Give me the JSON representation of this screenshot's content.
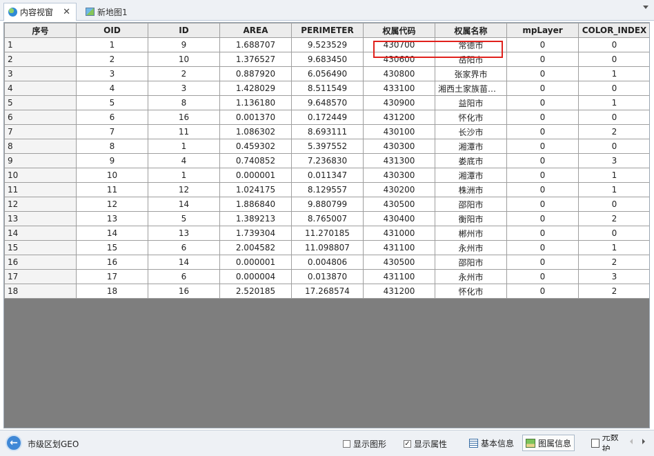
{
  "tabs": [
    {
      "label": "内容视窗",
      "active": true
    },
    {
      "label": "新地图1",
      "active": false
    }
  ],
  "table": {
    "columns": [
      "序号",
      "OID",
      "ID",
      "AREA",
      "PERIMETER",
      "权属代码",
      "权属名称",
      "mpLayer",
      "COLOR_INDEX"
    ],
    "rows": [
      [
        "1",
        "1",
        "9",
        "1.688707",
        "9.523529",
        "430700",
        "常德市",
        "0",
        "0"
      ],
      [
        "2",
        "2",
        "10",
        "1.376527",
        "9.683450",
        "430600",
        "岳阳市",
        "0",
        "0"
      ],
      [
        "3",
        "3",
        "2",
        "0.887920",
        "6.056490",
        "430800",
        "张家界市",
        "0",
        "1"
      ],
      [
        "4",
        "4",
        "3",
        "1.428029",
        "8.511549",
        "433100",
        "湘西土家族苗族…",
        "0",
        "0"
      ],
      [
        "5",
        "5",
        "8",
        "1.136180",
        "9.648570",
        "430900",
        "益阳市",
        "0",
        "1"
      ],
      [
        "6",
        "6",
        "16",
        "0.001370",
        "0.172449",
        "431200",
        "怀化市",
        "0",
        "0"
      ],
      [
        "7",
        "7",
        "11",
        "1.086302",
        "8.693111",
        "430100",
        "长沙市",
        "0",
        "2"
      ],
      [
        "8",
        "8",
        "1",
        "0.459302",
        "5.397552",
        "430300",
        "湘潭市",
        "0",
        "0"
      ],
      [
        "9",
        "9",
        "4",
        "0.740852",
        "7.236830",
        "431300",
        "娄底市",
        "0",
        "3"
      ],
      [
        "10",
        "10",
        "1",
        "0.000001",
        "0.011347",
        "430300",
        "湘潭市",
        "0",
        "1"
      ],
      [
        "11",
        "11",
        "12",
        "1.024175",
        "8.129557",
        "430200",
        "株洲市",
        "0",
        "1"
      ],
      [
        "12",
        "12",
        "14",
        "1.886840",
        "9.880799",
        "430500",
        "邵阳市",
        "0",
        "0"
      ],
      [
        "13",
        "13",
        "5",
        "1.389213",
        "8.765007",
        "430400",
        "衡阳市",
        "0",
        "2"
      ],
      [
        "14",
        "14",
        "13",
        "1.739304",
        "11.270185",
        "431000",
        "郴州市",
        "0",
        "0"
      ],
      [
        "15",
        "15",
        "6",
        "2.004582",
        "11.098807",
        "431100",
        "永州市",
        "0",
        "1"
      ],
      [
        "16",
        "16",
        "14",
        "0.000001",
        "0.004806",
        "430500",
        "邵阳市",
        "0",
        "2"
      ],
      [
        "17",
        "17",
        "6",
        "0.000004",
        "0.013870",
        "431100",
        "永州市",
        "0",
        "3"
      ],
      [
        "18",
        "18",
        "16",
        "2.520185",
        "17.268574",
        "431200",
        "怀化市",
        "0",
        "2"
      ]
    ]
  },
  "statusbar": {
    "layer_name": "市级区划GEO",
    "show_graphics_label": "显示图形",
    "show_graphics_checked": false,
    "show_attributes_label": "显示属性",
    "show_attributes_checked": true,
    "basic_info_label": "基本信息",
    "attr_info_label": "图属信息",
    "metadata_label": "元数护"
  },
  "colors": {
    "highlight": "#e0201b",
    "empty_area": "#7e7e7e"
  }
}
